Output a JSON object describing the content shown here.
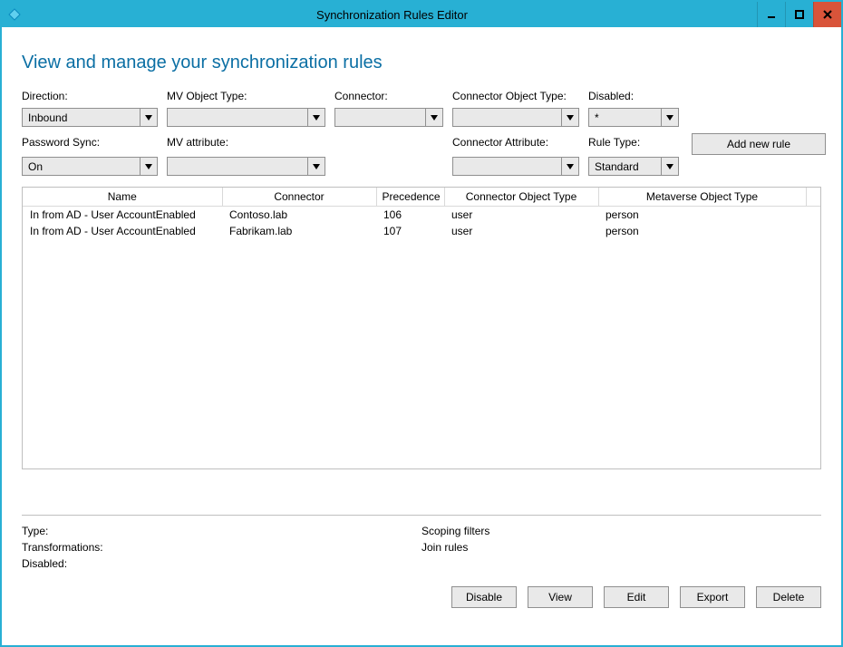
{
  "window": {
    "title": "Synchronization Rules Editor"
  },
  "heading": "View and manage your synchronization rules",
  "filters": {
    "labels": {
      "direction": "Direction:",
      "mv_object_type": "MV Object Type:",
      "connector": "Connector:",
      "connector_object_type": "Connector Object Type:",
      "disabled": "Disabled:",
      "password_sync": "Password Sync:",
      "mv_attribute": "MV attribute:",
      "connector_attribute": "Connector Attribute:",
      "rule_type": "Rule Type:"
    },
    "values": {
      "direction": "Inbound",
      "mv_object_type": "",
      "connector": "",
      "connector_object_type": "",
      "disabled": "*",
      "password_sync": "On",
      "mv_attribute": "",
      "connector_attribute": "",
      "rule_type": "Standard"
    }
  },
  "buttons": {
    "add_new_rule": "Add new rule",
    "disable": "Disable",
    "view": "View",
    "edit": "Edit",
    "export": "Export",
    "delete": "Delete"
  },
  "table": {
    "columns": {
      "name": "Name",
      "connector": "Connector",
      "precedence": "Precedence",
      "connector_object_type": "Connector Object Type",
      "metaverse_object_type": "Metaverse Object Type"
    },
    "rows": [
      {
        "name": "In from AD - User AccountEnabled",
        "connector": "Contoso.lab",
        "precedence": "106",
        "connector_object_type": "user",
        "metaverse_object_type": "person"
      },
      {
        "name": "In from AD - User AccountEnabled",
        "connector": "Fabrikam.lab",
        "precedence": "107",
        "connector_object_type": "user",
        "metaverse_object_type": "person"
      }
    ]
  },
  "details": {
    "left": {
      "type": "Type:",
      "transformations": "Transformations:",
      "disabled": "Disabled:"
    },
    "right": {
      "scoping_filters": "Scoping filters",
      "join_rules": "Join rules"
    }
  }
}
